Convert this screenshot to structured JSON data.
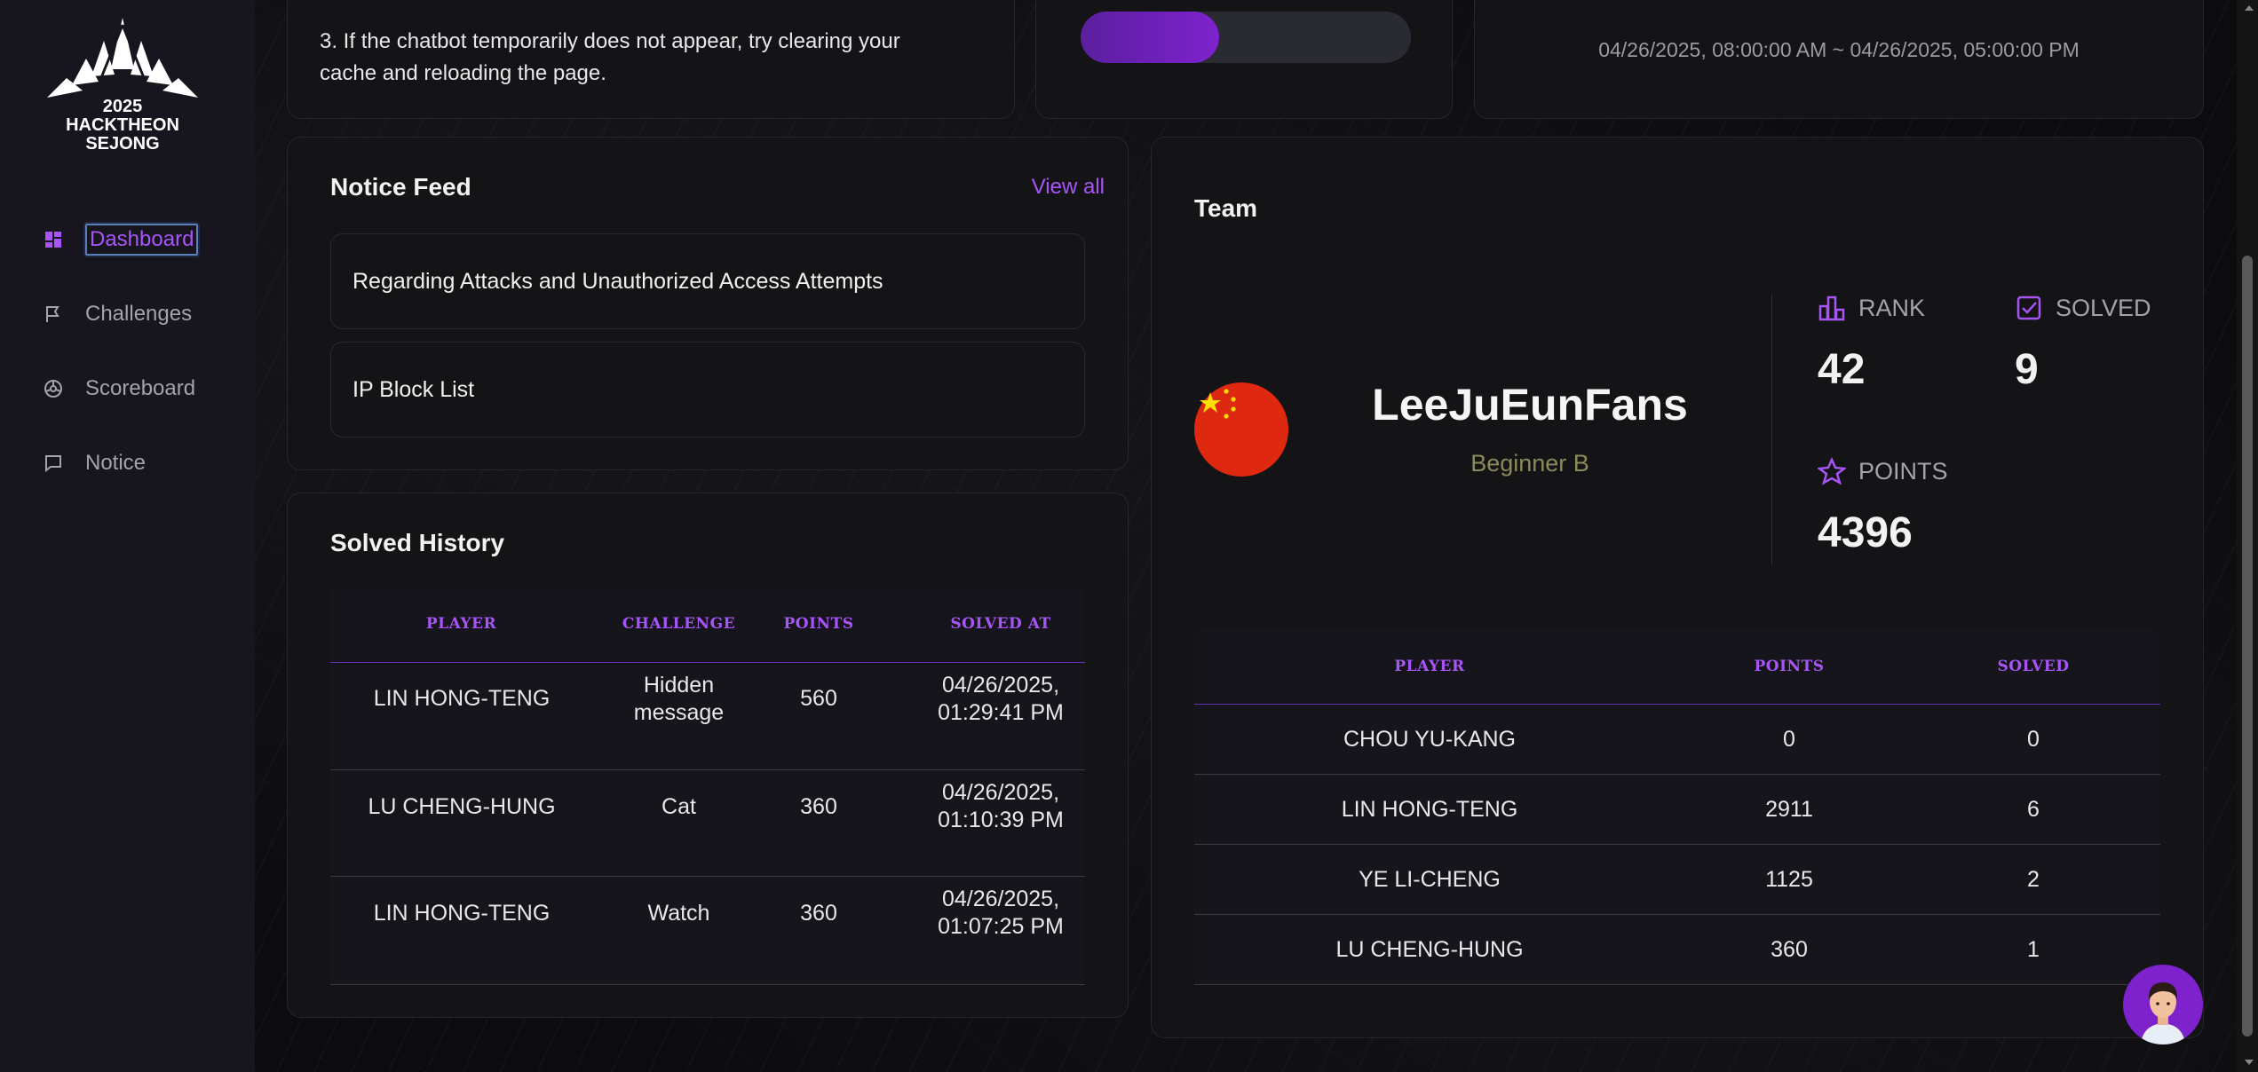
{
  "sidebar": {
    "logo": {
      "year": "2025",
      "line1": "HACKTHEON",
      "line2": "SEJONG"
    },
    "items": [
      {
        "label": "Dashboard",
        "icon": "dashboard-icon",
        "active": true
      },
      {
        "label": "Challenges",
        "icon": "flag-icon",
        "active": false
      },
      {
        "label": "Scoreboard",
        "icon": "scoreboard-icon",
        "active": false
      },
      {
        "label": "Notice",
        "icon": "message-icon",
        "active": false
      }
    ]
  },
  "top": {
    "instruction_line1": "3. If the chatbot temporarily does not appear, try clearing your",
    "instruction_line2": "cache and reloading the page.",
    "progress_fraction": 0.42,
    "time_range": "04/26/2025, 08:00:00 AM  ~  04/26/2025, 05:00:00 PM"
  },
  "notice_feed": {
    "title": "Notice Feed",
    "view_all": "View all",
    "items": [
      "Regarding Attacks and Unauthorized Access Attempts",
      "IP Block List"
    ]
  },
  "solved_history": {
    "title": "Solved History",
    "headers": [
      "PLAYER",
      "CHALLENGE",
      "POINTS",
      "SOLVED AT"
    ],
    "rows": [
      {
        "player": "LIN HONG-TENG",
        "challenge_l1": "Hidden",
        "challenge_l2": "message",
        "points": "560",
        "date": "04/26/2025,",
        "time": "01:29:41 PM"
      },
      {
        "player": "LU CHENG-HUNG",
        "challenge_l1": "Cat",
        "challenge_l2": "",
        "points": "360",
        "date": "04/26/2025,",
        "time": "01:10:39 PM"
      },
      {
        "player": "LIN HONG-TENG",
        "challenge_l1": "Watch",
        "challenge_l2": "",
        "points": "360",
        "date": "04/26/2025,",
        "time": "01:07:25 PM"
      }
    ]
  },
  "team": {
    "title": "Team",
    "name": "LeeJuEunFans",
    "division": "Beginner B",
    "flag_icon": "china-flag-icon",
    "rank_label": "RANK",
    "rank": "42",
    "solved_label": "SOLVED",
    "solved": "9",
    "points_label": "POINTS",
    "points": "4396",
    "headers": [
      "PLAYER",
      "POINTS",
      "SOLVED"
    ],
    "members": [
      {
        "player": "CHOU YU-KANG",
        "points": "0",
        "solved": "0"
      },
      {
        "player": "LIN HONG-TENG",
        "points": "2911",
        "solved": "6"
      },
      {
        "player": "YE LI-CHENG",
        "points": "1125",
        "solved": "2"
      },
      {
        "player": "LU CHENG-HUNG",
        "points": "360",
        "solved": "1"
      }
    ]
  },
  "colors": {
    "accent": "#a855f7",
    "sidebar": "#17161f",
    "card": "#141416",
    "division": "#8a8a5a"
  }
}
